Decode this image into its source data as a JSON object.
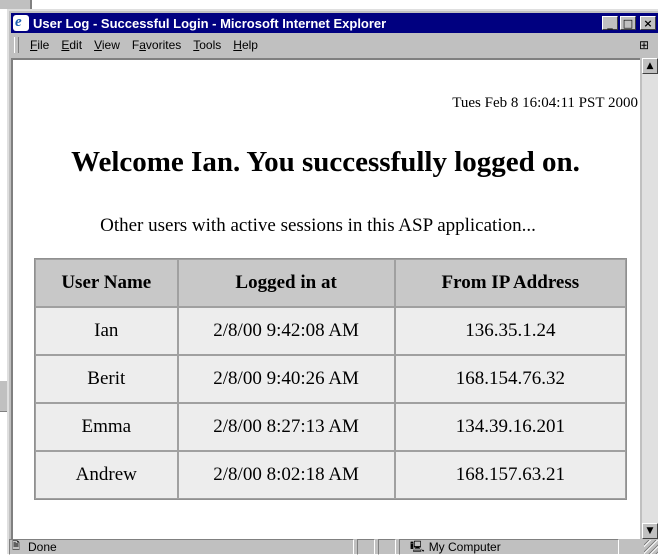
{
  "window": {
    "title": "User Log - Successful Login - Microsoft Internet Explorer",
    "minimize_glyph": "_",
    "maximize_glyph": "□",
    "close_glyph": "×"
  },
  "menu": [
    "File",
    "Edit",
    "View",
    "Favorites",
    "Tools",
    "Help"
  ],
  "menu_underlines": [
    "F",
    "E",
    "V",
    "a",
    "T",
    "H"
  ],
  "page": {
    "timestamp": "Tues Feb 8 16:04:11 PST 2000",
    "welcome": "Welcome Ian. You successfully logged on.",
    "subtitle": "Other users with active sessions in this ASP application...",
    "table": {
      "headers": [
        "User Name",
        "Logged in at",
        "From IP Address"
      ],
      "rows": [
        [
          "Ian",
          "2/8/00 9:42:08 AM",
          "136.35.1.24"
        ],
        [
          "Berit",
          "2/8/00 9:40:26 AM",
          "168.154.76.32"
        ],
        [
          "Emma",
          "2/8/00 8:27:13 AM",
          "134.39.16.201"
        ],
        [
          "Andrew",
          "2/8/00 8:02:18 AM",
          "168.157.63.21"
        ]
      ]
    }
  },
  "status": {
    "text": "Done",
    "zone": "My Computer"
  },
  "icons": {
    "app": "internet-explorer-icon",
    "throbber": "windows-logo-icon",
    "status_page": "page-icon",
    "zone": "my-computer-icon"
  },
  "colors": {
    "titlebar": "#000080",
    "chrome": "#c0c0c0",
    "table_header": "#c8c8c8",
    "table_cell": "#ededed"
  }
}
